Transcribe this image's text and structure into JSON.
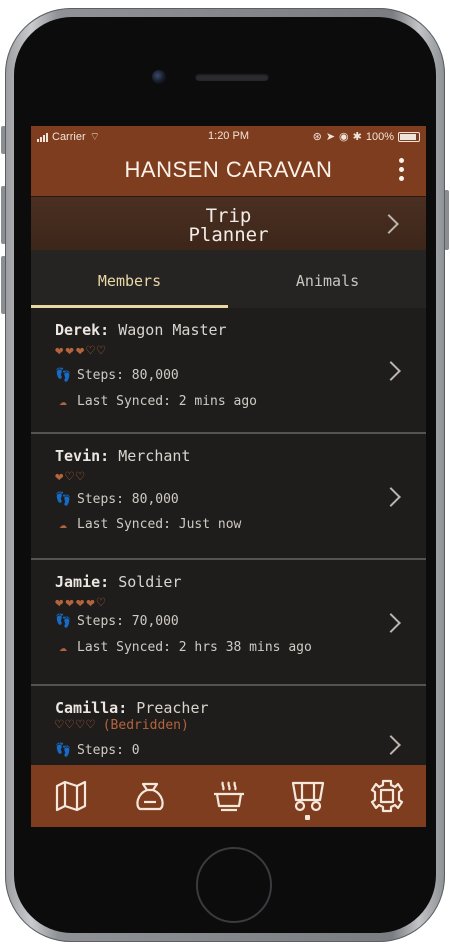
{
  "status_bar": {
    "carrier": "Carrier",
    "time": "1:20 PM",
    "battery": "100%"
  },
  "app_bar": {
    "title": "HANSEN CARAVAN"
  },
  "trip_planner": {
    "label": "Trip\nPlanner"
  },
  "tabs": [
    {
      "label": "Members",
      "active": true
    },
    {
      "label": "Animals",
      "active": false
    }
  ],
  "members": [
    {
      "name": "Derek:",
      "role": "Wagon Master",
      "hearts": "❤❤❤♡♡",
      "status": "",
      "steps": "Steps: 80,000",
      "synced": "Last Synced: 2 mins ago"
    },
    {
      "name": "Tevin:",
      "role": "Merchant",
      "hearts": "❤♡♡",
      "status": "",
      "steps": "Steps: 80,000",
      "synced": "Last Synced: Just now"
    },
    {
      "name": "Jamie:",
      "role": "Soldier",
      "hearts": "❤❤❤❤♡",
      "status": "",
      "steps": "Steps: 70,000",
      "synced": "Last Synced: 2 hrs 38 mins ago"
    },
    {
      "name": "Camilla:",
      "role": "Preacher",
      "hearts": "♡♡♡♡",
      "status": "(Bedridden)",
      "steps": "Steps: 0",
      "synced": ""
    }
  ],
  "bottom_nav": [
    {
      "icon": "map-icon"
    },
    {
      "icon": "pouch-icon"
    },
    {
      "icon": "food-pot-icon"
    },
    {
      "icon": "wagon-icon",
      "active": true
    },
    {
      "icon": "settings-gear-icon"
    }
  ],
  "colors": {
    "accent": "#7f3d1f",
    "background": "#1e1c1a",
    "heart": "#b4643c",
    "tab_highlight": "#e8d6a4"
  }
}
